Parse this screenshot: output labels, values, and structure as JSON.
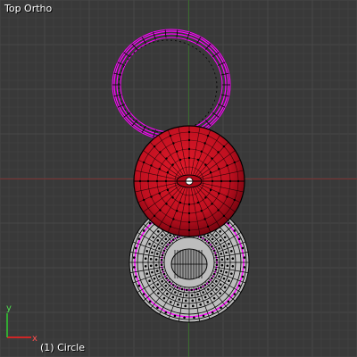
{
  "viewport": {
    "view_name": "Top Ortho",
    "object_info": "(1) Circle",
    "axis_labels": {
      "x": "x",
      "y": "y"
    }
  },
  "colors": {
    "background": "#393939",
    "grid_minor": "#404040",
    "grid_major": "#474747",
    "x_axis": "#7a3030",
    "y_axis": "#3a6b2e",
    "selected_edges": "#ff00ff",
    "selected_face": "#c01020",
    "unselected_mesh": "#bdbdbd",
    "wire_black": "#000000"
  },
  "objects": [
    {
      "name": "ring-torus",
      "state": "selected-edges"
    },
    {
      "name": "sphere",
      "state": "selected-faces"
    },
    {
      "name": "disk-mesh",
      "state": "unselected"
    }
  ]
}
